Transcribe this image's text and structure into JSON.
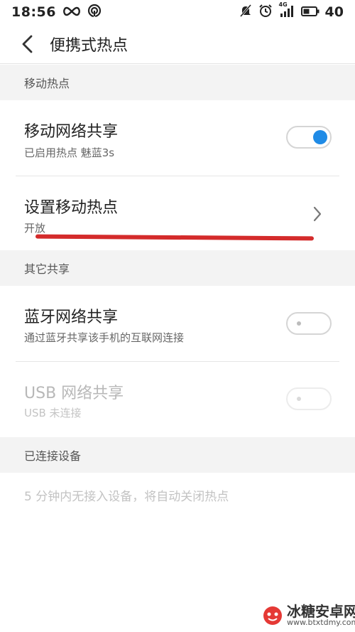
{
  "status_bar": {
    "time": "18:56",
    "network_label": "4G",
    "battery": "40"
  },
  "header": {
    "title": "便携式热点"
  },
  "sections": {
    "mobile_hotspot": {
      "label": "移动热点"
    },
    "other_sharing": {
      "label": "其它共享"
    },
    "connected_devices": {
      "label": "已连接设备"
    }
  },
  "rows": {
    "mobile_network_sharing": {
      "title": "移动网络共享",
      "subtitle": "已启用热点 魅蓝3s",
      "toggle": "on"
    },
    "setup_hotspot": {
      "title": "设置移动热点",
      "subtitle": "开放"
    },
    "bluetooth_sharing": {
      "title": "蓝牙网络共享",
      "subtitle": "通过蓝牙共享该手机的互联网连接",
      "toggle": "off"
    },
    "usb_sharing": {
      "title": "USB 网络共享",
      "subtitle": "USB 未连接",
      "toggle": "off",
      "disabled": true
    }
  },
  "connected_note": "5 分钟内无接入设备，将自动关闭热点",
  "watermark": {
    "title": "冰糖安卓网",
    "url": "www.btxtdmy.com"
  },
  "colors": {
    "accent": "#1f8be6",
    "annotation": "#d42b2b"
  }
}
